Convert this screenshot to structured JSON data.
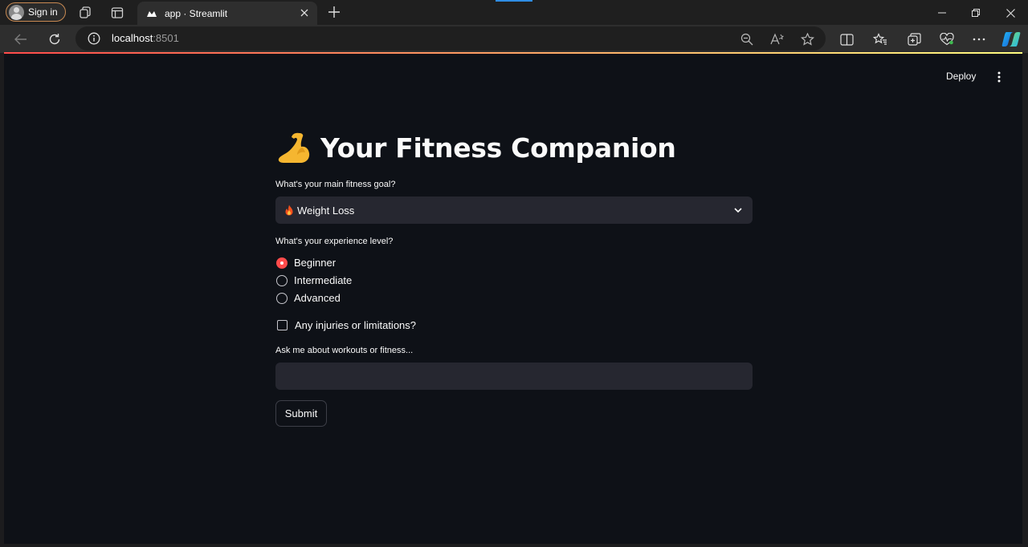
{
  "browser": {
    "sign_in_label": "Sign in",
    "tab_title": "app · Streamlit",
    "url_host": "localhost",
    "url_port": ":8501"
  },
  "app": {
    "deploy_label": "Deploy",
    "title": "Your Fitness Companion",
    "title_icon": "flexed-biceps-emoji",
    "goal_label": "What's your main fitness goal?",
    "goal_selected": "Weight Loss",
    "goal_icon": "fire-emoji",
    "experience_label": "What's your experience level?",
    "experience_options": [
      "Beginner",
      "Intermediate",
      "Advanced"
    ],
    "experience_selected": "Beginner",
    "injuries_label": "Any injuries or limitations?",
    "injuries_checked": false,
    "question_label": "Ask me about workouts or fitness...",
    "question_value": "",
    "submit_label": "Submit",
    "accent_color": "#ff4b4b"
  }
}
